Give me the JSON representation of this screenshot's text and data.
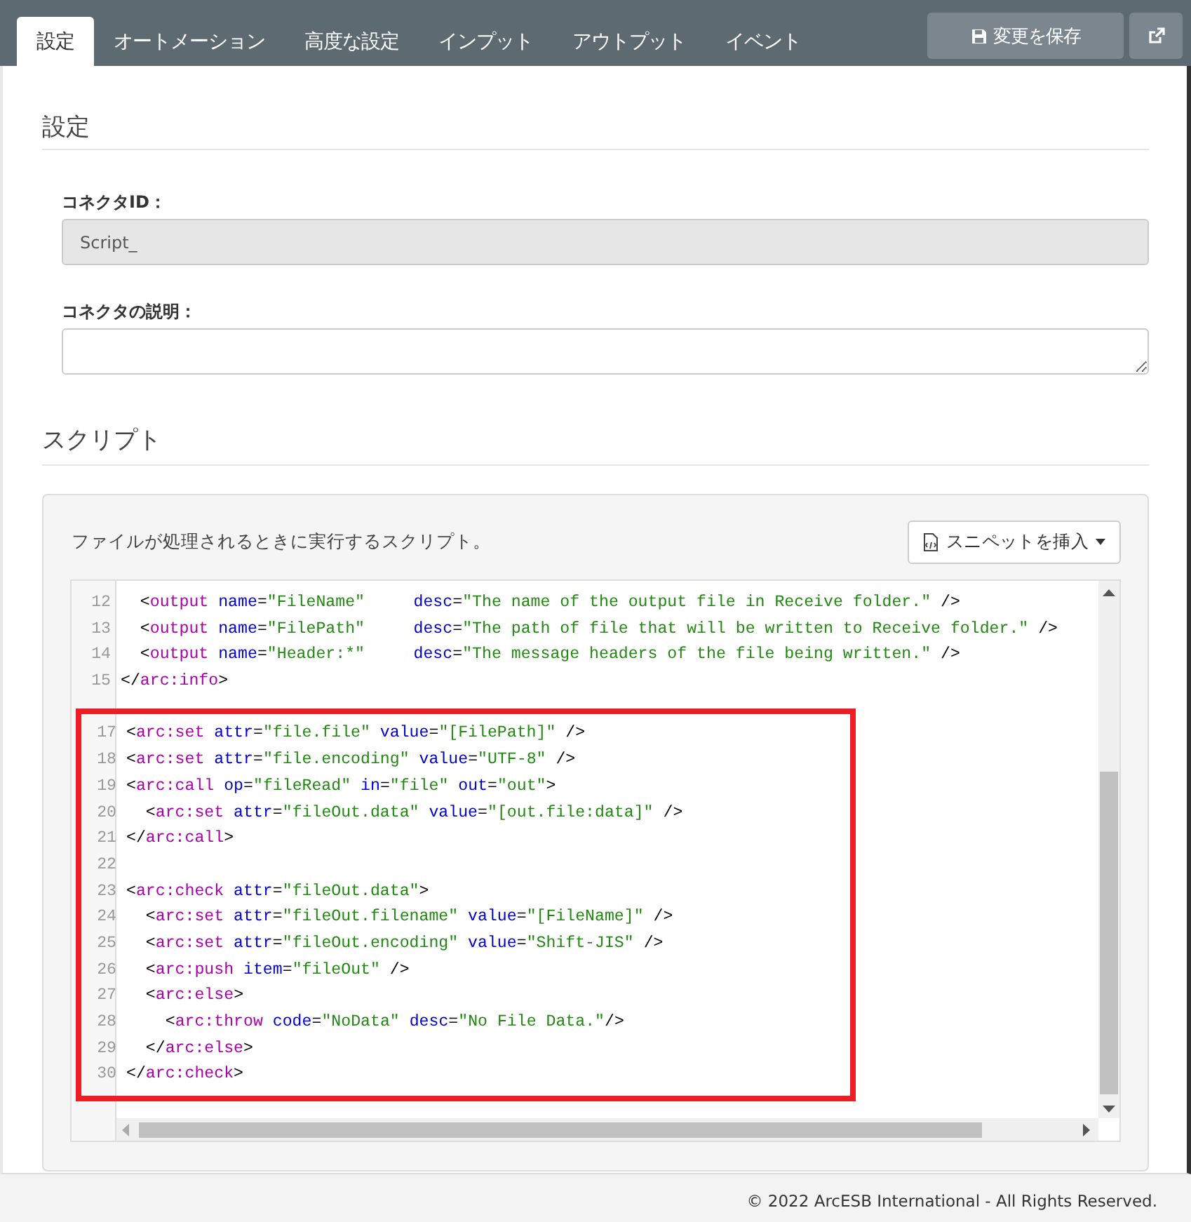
{
  "tabs": [
    {
      "label": "設定",
      "selected": true
    },
    {
      "label": "オートメーション",
      "selected": false
    },
    {
      "label": "高度な設定",
      "selected": false
    },
    {
      "label": "インプット",
      "selected": false
    },
    {
      "label": "アウトプット",
      "selected": false
    },
    {
      "label": "イベント",
      "selected": false
    }
  ],
  "save_button": {
    "label": "変更を保存"
  },
  "settings": {
    "heading": "設定",
    "fields": [
      {
        "label": "コネクタID：",
        "value": "Script_",
        "kind": "input",
        "disabled": true
      },
      {
        "label": "コネクタの説明：",
        "kind": "textarea",
        "disabled": false
      }
    ]
  },
  "script": {
    "heading": "スクリプト",
    "description": "ファイルが処理されるときに実行するスクリプト。",
    "snippet_button": {
      "label": "スニペットを挿入"
    },
    "editor": {
      "blocks": [
        {
          "highlighted": false,
          "lines": [
            {
              "number": "12",
              "text": "  <output name=\"FileName\"     desc=\"The name of the output file in Receive folder.\" />"
            },
            {
              "number": "13",
              "text": "  <output name=\"FilePath\"     desc=\"The path of file that will be written to Receive folder.\" />"
            },
            {
              "number": "14",
              "text": "  <output name=\"Header:*\"     desc=\"The message headers of the file being written.\" />"
            },
            {
              "number": "15",
              "text": "</arc:info>"
            }
          ]
        },
        {
          "highlighted": true,
          "lines": [
            {
              "number": "17",
              "text": "<arc:set attr=\"file.file\" value=\"[FilePath]\" />"
            },
            {
              "number": "18",
              "text": "<arc:set attr=\"file.encoding\" value=\"UTF-8\" />"
            },
            {
              "number": "19",
              "text": "<arc:call op=\"fileRead\" in=\"file\" out=\"out\">"
            },
            {
              "number": "20",
              "text": "  <arc:set attr=\"fileOut.data\" value=\"[out.file:data]\" />"
            },
            {
              "number": "21",
              "text": "</arc:call>"
            },
            {
              "number": "22"
            },
            {
              "number": "23",
              "text": "<arc:check attr=\"fileOut.data\">"
            },
            {
              "number": "24",
              "text": "  <arc:set attr=\"fileOut.filename\" value=\"[FileName]\" />"
            },
            {
              "number": "25",
              "text": "  <arc:set attr=\"fileOut.encoding\" value=\"Shift-JIS\" />"
            },
            {
              "number": "26",
              "text": "  <arc:push item=\"fileOut\" />"
            },
            {
              "number": "27",
              "text": "  <arc:else>"
            },
            {
              "number": "28",
              "text": "    <arc:throw code=\"NoData\" desc=\"No File Data.\"/>"
            },
            {
              "number": "29",
              "text": "  </arc:else>"
            },
            {
              "number": "30",
              "text": "</arc:check>"
            }
          ]
        }
      ]
    }
  },
  "footer": {
    "copyright": "© 2022 ArcESB International - All Rights Reserved."
  }
}
